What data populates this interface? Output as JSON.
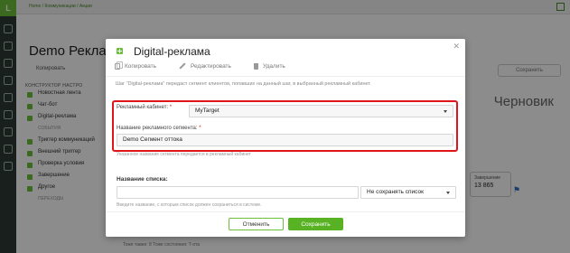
{
  "background": {
    "breadcrumbs": "Home / Коммуникации / Акции",
    "page_title": "Demo Реклам",
    "copy_label": "Копировать",
    "tabs": "КОНСТРУКТОР     НАСТРО",
    "save_label": "Сохранить",
    "status": "Черновик",
    "list_items": [
      "Новостная лента",
      "Чат-бот",
      "Digital-реклама"
    ],
    "section_events": "СОБЫТИЯ",
    "list_items_2": [
      "Триггер коммуникаций",
      "Внешний триггер",
      "Проверка условия",
      "Завершение"
    ],
    "section_other": "Другое",
    "section_other_sub": "ПЕРЕХОДЫ",
    "node_label": "Завершение",
    "node_value": "13 865",
    "footer": "Тоже также: 8     Тоже состояния: Т-ота"
  },
  "modal": {
    "title": "Digital-реклама",
    "actions": {
      "copy": "Копировать",
      "edit": "Редактировать",
      "delete": "Удалить"
    },
    "description": "Шаг \"Digital-реклама\" передаст сегмент клиентов, попавших на данный шаг, в выбранный рекламный кабинет.",
    "ad_account": {
      "label": "Рекламный кабинет:",
      "required_mark": "*",
      "value": "MyTarget"
    },
    "segment_name": {
      "label": "Название рекламного сегмента:",
      "required_mark": "*",
      "value": "Demo Сегмент оттока",
      "hint": "Указанное название сегмента передается в рекламный кабинет"
    },
    "list_name": {
      "label": "Название списка:",
      "value": "",
      "select_value": "Не сохранять список",
      "hint": "Введите название, с которым список должен сохраниться в системе."
    },
    "buttons": {
      "cancel": "Отменить",
      "save": "Сохранить"
    }
  },
  "colors": {
    "accent": "#59b224",
    "highlight": "#e0151a"
  }
}
